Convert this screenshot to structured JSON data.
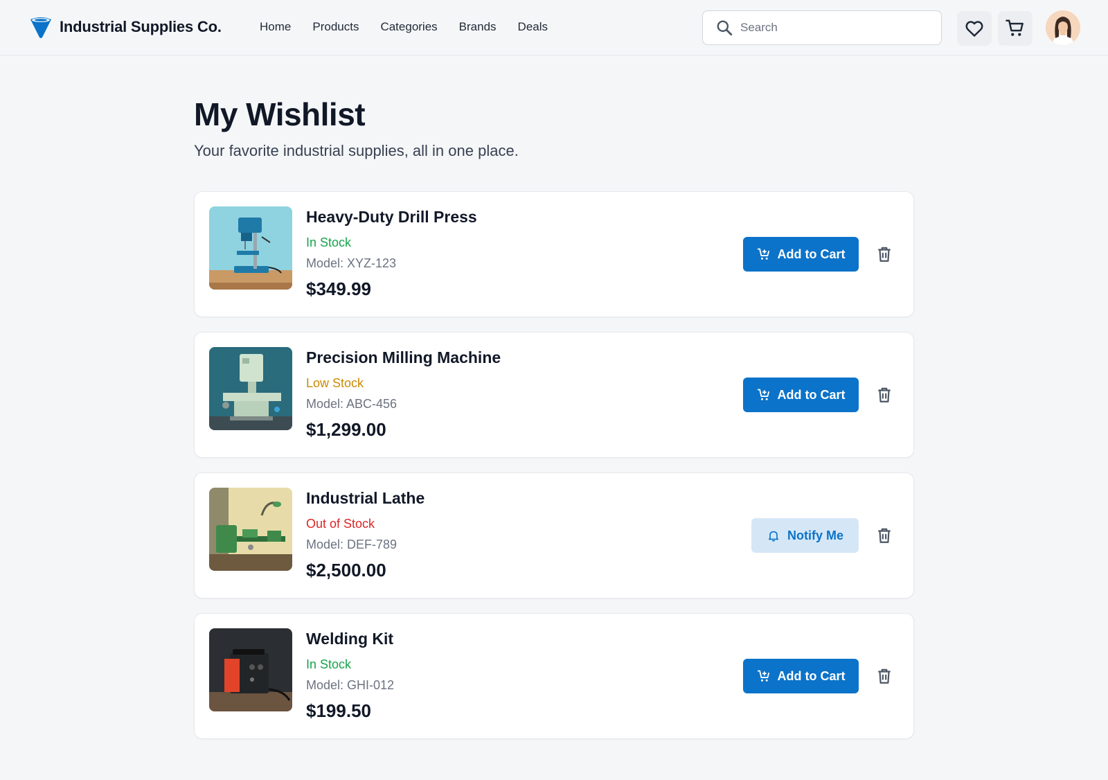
{
  "header": {
    "brand_name": "Industrial Supplies Co.",
    "brand_logo_icon": "funnel-logo-icon",
    "nav": [
      "Home",
      "Products",
      "Categories",
      "Brands",
      "Deals"
    ],
    "search_placeholder": "Search",
    "search_value": "",
    "wishlist_icon": "heart-icon",
    "cart_icon": "cart-icon",
    "accent_color": "#0b73c9"
  },
  "page": {
    "title": "My Wishlist",
    "subtitle": "Your favorite industrial supplies, all in one place."
  },
  "status_colors": {
    "In Stock": "#16a34a",
    "Low Stock": "#ca8a04",
    "Out of Stock": "#dc2626"
  },
  "items": [
    {
      "name": "Heavy-Duty Drill Press",
      "stock": "In Stock",
      "stock_color": "#16a34a",
      "model": "Model: XYZ-123",
      "price": "$349.99",
      "action_label": "Add to Cart",
      "action_icon": "add-cart-icon"
    },
    {
      "name": "Precision Milling Machine",
      "stock": "Low Stock",
      "stock_color": "#ca8a04",
      "model": "Model: ABC-456",
      "price": "$1,299.00",
      "action_label": "Add to Cart",
      "action_icon": "add-cart-icon"
    },
    {
      "name": "Industrial Lathe",
      "stock": "Out of Stock",
      "stock_color": "#dc2626",
      "model": "Model: DEF-789",
      "price": "$2,500.00",
      "action_label": "Notify Me",
      "action_icon": "bell-icon"
    },
    {
      "name": "Welding Kit",
      "stock": "In Stock",
      "stock_color": "#16a34a",
      "model": "Model: GHI-012",
      "price": "$199.50",
      "action_label": "Add to Cart",
      "action_icon": "add-cart-icon"
    }
  ]
}
